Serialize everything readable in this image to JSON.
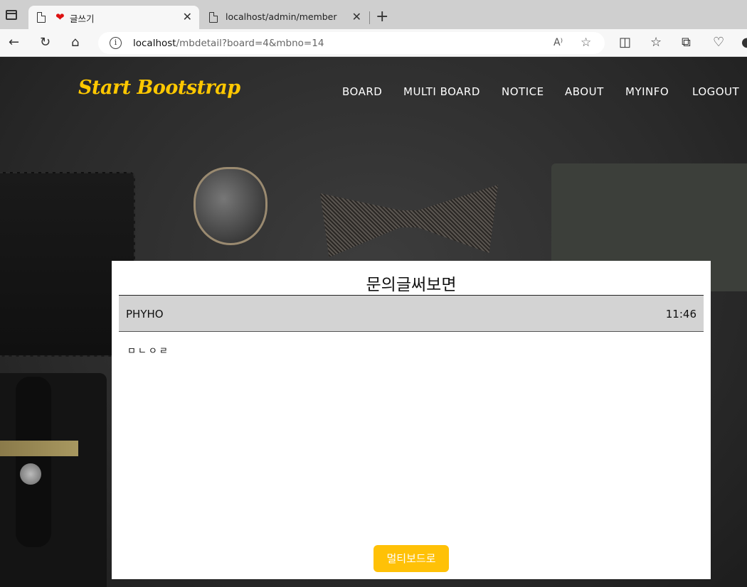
{
  "browser": {
    "tabs": [
      {
        "title": "글쓰기",
        "active": true
      },
      {
        "title": "localhost/admin/member",
        "active": false
      }
    ],
    "url_host": "localhost",
    "url_path": "/mbdetail?board=4&mbno=14"
  },
  "navbar": {
    "brand": "Start Bootstrap",
    "items": [
      "BOARD",
      "MULTI BOARD",
      "NOTICE",
      "ABOUT",
      "MYINFO",
      "LOGOUT"
    ]
  },
  "post": {
    "title": "문의글써보면",
    "author": "PHYHO",
    "time": "11:46",
    "body": "ㅁㄴㅇㄹ"
  },
  "actions": {
    "back_label": "멀티보드로"
  },
  "colors": {
    "brand": "#ffc800",
    "button": "#ffc107"
  }
}
